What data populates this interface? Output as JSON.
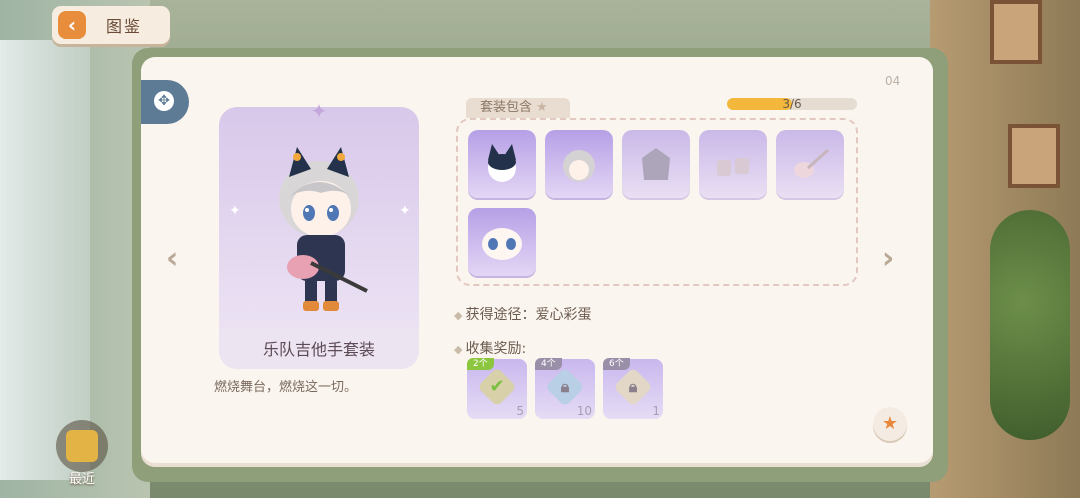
{
  "header": {
    "back_label": "图鉴",
    "back_icon": "chevron-left-icon"
  },
  "panel": {
    "page_index": "04"
  },
  "outfit": {
    "name": "乐队吉他手套装",
    "description": "燃烧舞台，燃烧这一切。"
  },
  "suit": {
    "label": "套装包含",
    "progress_text": "3/6",
    "progress_fraction": 0.5,
    "items": [
      {
        "name": "cat-ear-headphone-hat",
        "owned": true
      },
      {
        "name": "silver-hair",
        "owned": true
      },
      {
        "name": "black-jacket",
        "owned": false
      },
      {
        "name": "boots",
        "owned": false
      },
      {
        "name": "electric-guitar",
        "owned": false
      },
      {
        "name": "blue-eyes-face",
        "owned": true
      }
    ]
  },
  "source": {
    "label": "获得途径：",
    "value": "爱心彩蛋"
  },
  "rewards": {
    "label": "收集奖励:",
    "items": [
      {
        "tag": "2个",
        "count": "5",
        "state": "claimed",
        "tag_color": "#8cc63f"
      },
      {
        "tag": "4个",
        "count": "10",
        "state": "locked",
        "tag_color": "#9a8fa8"
      },
      {
        "tag": "6个",
        "count": "1",
        "state": "locked",
        "tag_color": "#9a8fa8"
      }
    ]
  },
  "recent": {
    "label": "最近"
  },
  "colors": {
    "accent": "#e88d3c",
    "progress": "#f2b73b",
    "panel": "#fbf5ef",
    "tab": "#5e7b96"
  }
}
